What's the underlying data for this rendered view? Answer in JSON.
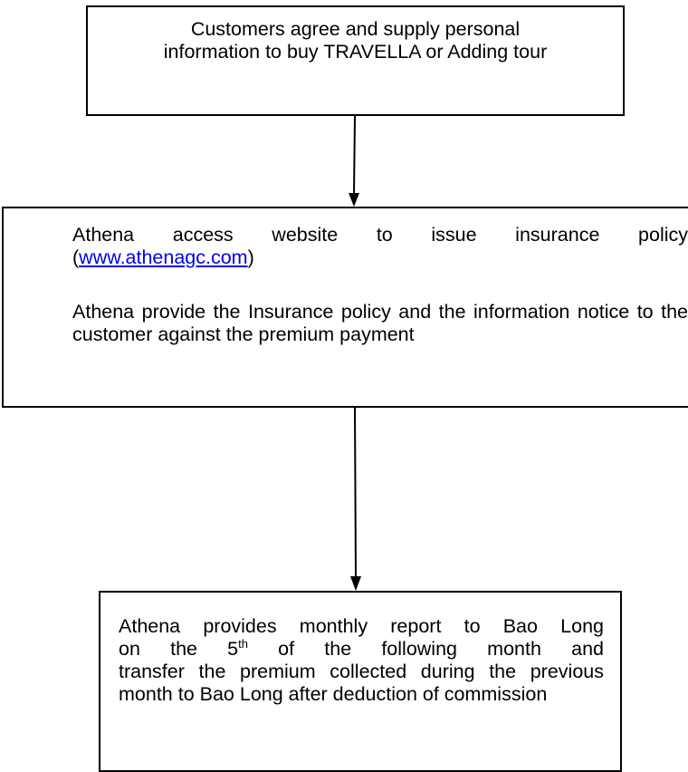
{
  "steps": [
    {
      "line1": "Customers agree and supply personal",
      "line2": "information to buy TRAVELLA or Adding tour"
    },
    {
      "para1_line1": "Athena access website to issue insurance policy",
      "para1_open": "(",
      "link_text": "www.athenagc.com",
      "para1_close": ")",
      "para2": "Athena provide the Insurance policy and the information notice to the customer against the premium payment"
    },
    {
      "line1": "Athena provides monthly report to Bao Long",
      "line2_before": "on the 5",
      "line2_sup": "th",
      "line2_after": " of the following month and",
      "rest": "transfer the premium collected during the previous month to Bao Long after deduction of commission"
    }
  ],
  "colors": {
    "border": "#000000",
    "link": "#0000ee",
    "background": "#ffffff"
  }
}
